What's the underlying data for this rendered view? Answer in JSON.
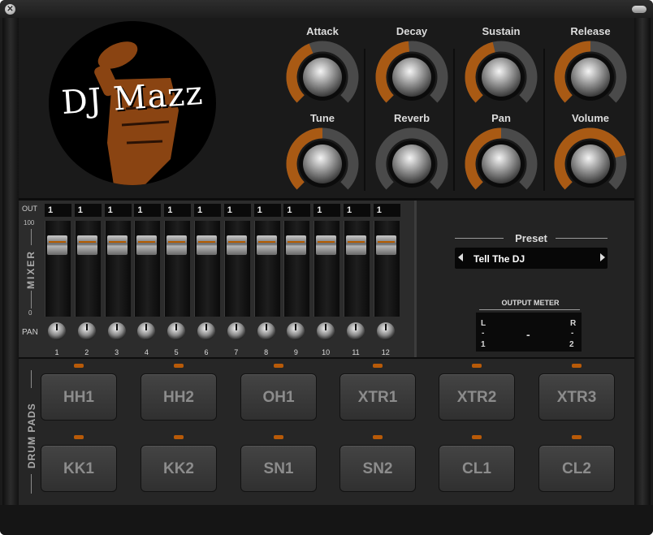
{
  "window": {
    "close_symbol": "✕"
  },
  "logo": {
    "text": "DJ Mazz"
  },
  "envelope_knobs": [
    {
      "label": "Attack",
      "value": 0.42
    },
    {
      "label": "Decay",
      "value": 0.48
    },
    {
      "label": "Sustain",
      "value": 0.45
    },
    {
      "label": "Release",
      "value": 0.5
    }
  ],
  "tone_knobs": [
    {
      "label": "Tune",
      "value": 0.5
    },
    {
      "label": "Reverb",
      "value": 0.0
    },
    {
      "label": "Pan",
      "value": 0.5
    },
    {
      "label": "Volume",
      "value": 0.78
    }
  ],
  "mixer": {
    "out_label": "OUT",
    "title": "MIXER",
    "scale_max": "100",
    "scale_min": "0",
    "pan_label": "PAN",
    "channels": [
      {
        "num": "1",
        "out": "1"
      },
      {
        "num": "2",
        "out": "1"
      },
      {
        "num": "3",
        "out": "1"
      },
      {
        "num": "4",
        "out": "1"
      },
      {
        "num": "5",
        "out": "1"
      },
      {
        "num": "6",
        "out": "1"
      },
      {
        "num": "7",
        "out": "1"
      },
      {
        "num": "8",
        "out": "1"
      },
      {
        "num": "9",
        "out": "1"
      },
      {
        "num": "10",
        "out": "1"
      },
      {
        "num": "11",
        "out": "1"
      },
      {
        "num": "12",
        "out": "1"
      }
    ]
  },
  "preset": {
    "title": "Preset",
    "value": "Tell The DJ"
  },
  "output_meter": {
    "title": "OUTPUT METER",
    "left": "L",
    "right": "R",
    "left_num": "1",
    "right_num": "2",
    "left_dash": "-",
    "right_dash": "-",
    "center_dash": "-"
  },
  "drum_pads": {
    "title": "DRUM PADS",
    "pads": [
      {
        "label": "HH1"
      },
      {
        "label": "HH2"
      },
      {
        "label": "OH1"
      },
      {
        "label": "XTR1"
      },
      {
        "label": "XTR2"
      },
      {
        "label": "XTR3"
      },
      {
        "label": "KK1"
      },
      {
        "label": "KK2"
      },
      {
        "label": "SN1"
      },
      {
        "label": "SN2"
      },
      {
        "label": "CL1"
      },
      {
        "label": "CL2"
      }
    ]
  },
  "colors": {
    "accent": "#a95a14",
    "panel": "#1a1a1a"
  }
}
